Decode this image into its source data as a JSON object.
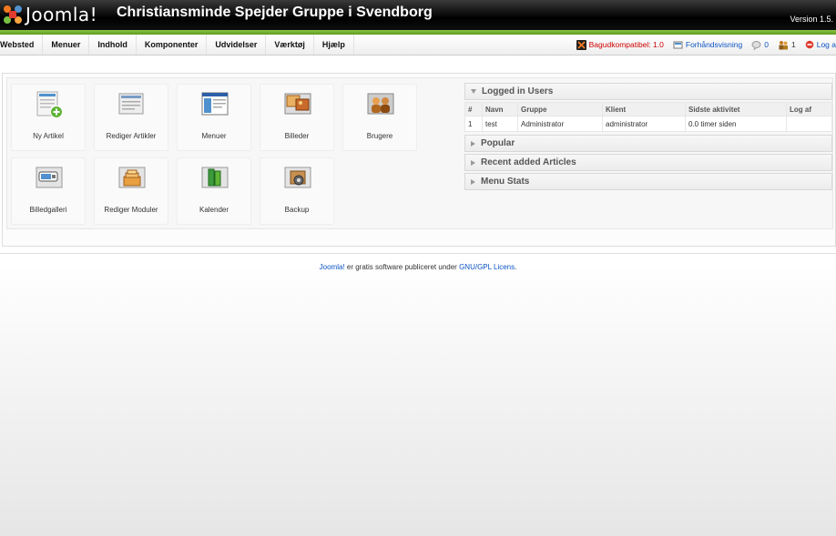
{
  "header": {
    "logo_text": "Joomla!",
    "site_title": "Christiansminde Spejder Gruppe i Svendborg",
    "version": "Version 1.5."
  },
  "menu": [
    "Websted",
    "Menuer",
    "Indhold",
    "Komponenter",
    "Udvidelser",
    "Værktøj",
    "Hjælp"
  ],
  "status": {
    "legacy": "Bagudkompatibel: 1.0",
    "preview": "Forhåndsvisning",
    "messages": "0",
    "users_online": "1",
    "logout": "Log a"
  },
  "cpanel_icons": [
    {
      "label": "Ny Artikel",
      "icon": "new-article-icon"
    },
    {
      "label": "Rediger Artikler",
      "icon": "article-manager-icon"
    },
    {
      "label": "Menuer",
      "icon": "menu-manager-icon"
    },
    {
      "label": "Billeder",
      "icon": "media-manager-icon"
    },
    {
      "label": "Brugere",
      "icon": "user-manager-icon"
    },
    {
      "label": "Billedgalleri",
      "icon": "image-gallery-icon"
    },
    {
      "label": "Rediger Moduler",
      "icon": "module-manager-icon"
    },
    {
      "label": "Kalender",
      "icon": "calendar-icon"
    },
    {
      "label": "Backup",
      "icon": "backup-icon"
    }
  ],
  "panels": {
    "logged_in": {
      "title": "Logged in Users",
      "columns": [
        "#",
        "Navn",
        "Gruppe",
        "Klient",
        "Sidste aktivitet",
        "Log af"
      ],
      "rows": [
        {
          "num": "1",
          "name": "test",
          "group": "Administrator",
          "client": "administrator",
          "last": "0.0 timer siden",
          "logout": ""
        }
      ]
    },
    "popular": "Popular",
    "recent": "Recent added Articles",
    "menu_stats": "Menu Stats"
  },
  "footer": {
    "link1": "Joomla!",
    "middle": " er gratis software publiceret under ",
    "link2": "GNU/GPL Licens",
    "end": "."
  }
}
